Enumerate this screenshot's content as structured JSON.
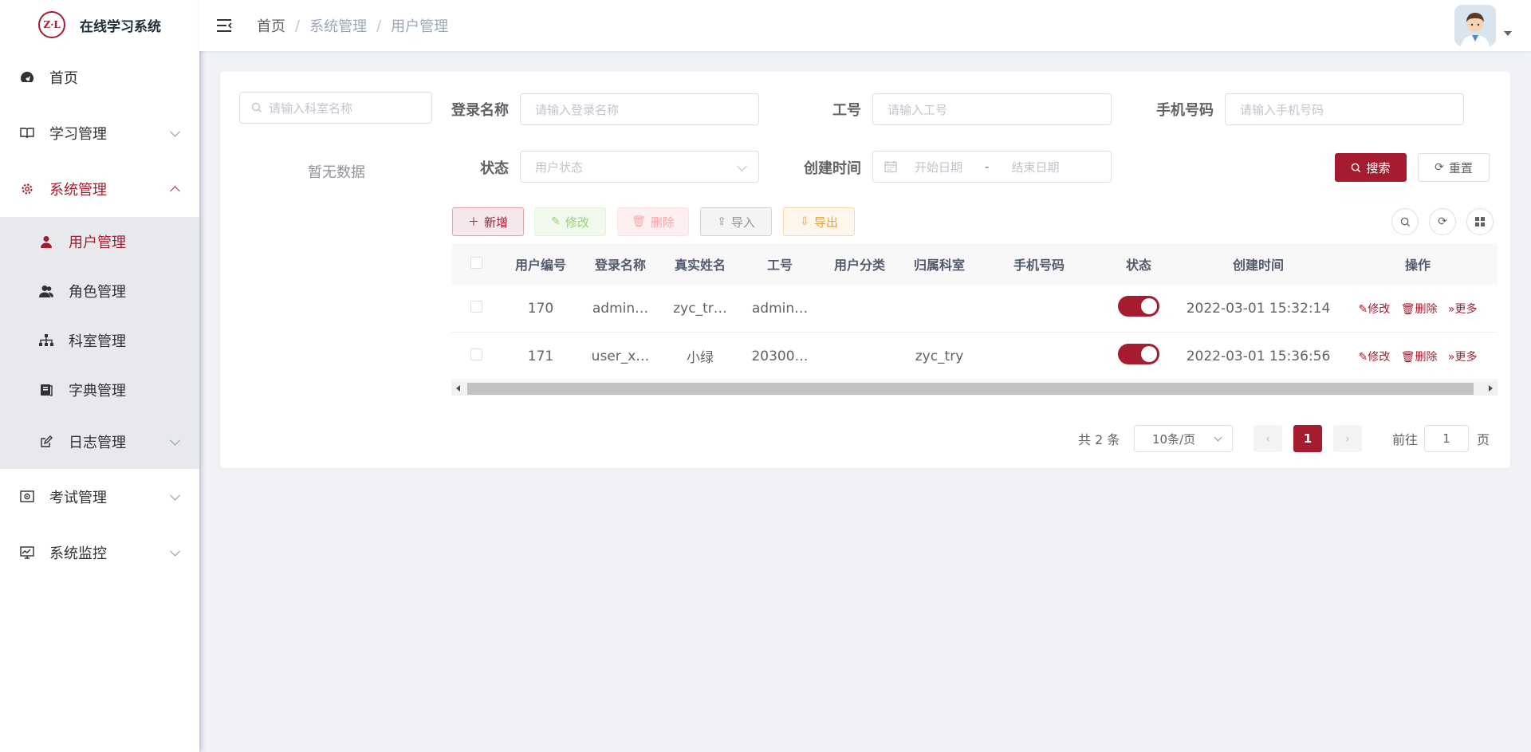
{
  "app": {
    "title": "在线学习系统",
    "logo_text": "Z·L"
  },
  "sidebar": {
    "items": [
      {
        "label": "首页"
      },
      {
        "label": "学习管理"
      },
      {
        "label": "系统管理"
      },
      {
        "label": "考试管理"
      },
      {
        "label": "系统监控"
      }
    ],
    "submenu": [
      {
        "label": "用户管理"
      },
      {
        "label": "角色管理"
      },
      {
        "label": "科室管理"
      },
      {
        "label": "字典管理"
      },
      {
        "label": "日志管理"
      }
    ]
  },
  "breadcrumb": [
    "首页",
    "系统管理",
    "用户管理"
  ],
  "dept": {
    "placeholder": "请输入科室名称",
    "empty": "暂无数据"
  },
  "filters": {
    "login_label": "登录名称",
    "login_placeholder": "请输入登录名称",
    "job_label": "工号",
    "job_placeholder": "请输入工号",
    "phone_label": "手机号码",
    "phone_placeholder": "请输入手机号码",
    "status_label": "状态",
    "status_placeholder": "用户状态",
    "time_label": "创建时间",
    "start_placeholder": "开始日期",
    "range_sep": "-",
    "end_placeholder": "结束日期",
    "search": "搜索",
    "reset": "重置"
  },
  "toolbar": {
    "add": "新增",
    "edit": "修改",
    "delete": "删除",
    "import": "导入",
    "export": "导出"
  },
  "table": {
    "headers": [
      "用户编号",
      "登录名称",
      "真实姓名",
      "工号",
      "用户分类",
      "归属科室",
      "手机号码",
      "状态",
      "创建时间",
      "操作"
    ],
    "rows": [
      {
        "id": "170",
        "login": "admin…",
        "name": "zyc_tr…",
        "job": "admin…",
        "category": "",
        "dept": "",
        "phone": "",
        "time": "2022-03-01 15:32:14"
      },
      {
        "id": "171",
        "login": "user_x…",
        "name": "小绿",
        "job": "20300…",
        "category": "",
        "dept": "zyc_try",
        "phone": "",
        "time": "2022-03-01 15:36:56"
      }
    ],
    "ops": {
      "edit": "修改",
      "delete": "删除",
      "more": "更多"
    }
  },
  "pagination": {
    "total": "共 2 条",
    "page_size": "10条/页",
    "current": "1",
    "goto_label": "前往",
    "goto_value": "1",
    "page_suffix": "页"
  },
  "colors": {
    "accent": "#a51c30"
  }
}
